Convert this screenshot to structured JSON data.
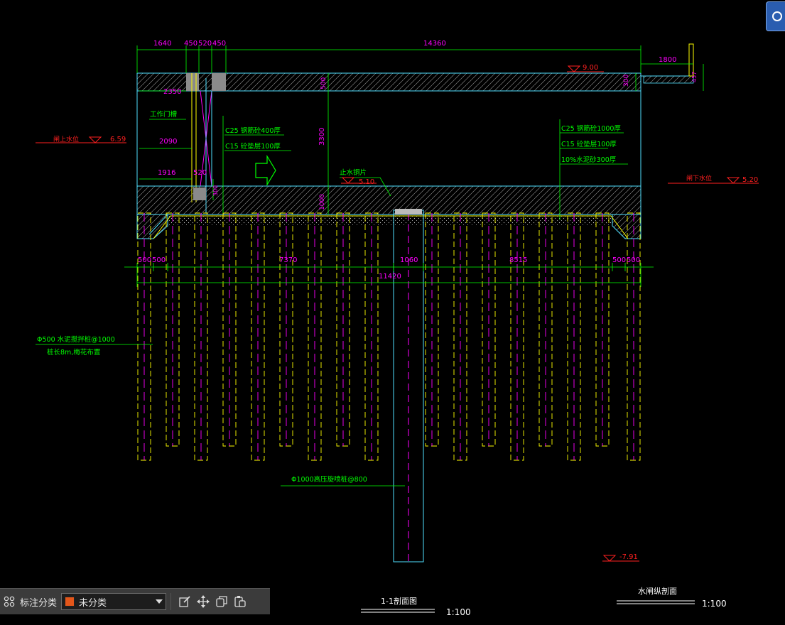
{
  "dimensions": {
    "top": [
      "1640",
      "450",
      "520",
      "450",
      "14360"
    ],
    "right_offset": "1800",
    "right_small": "457",
    "wall_2350": "2350",
    "wall_2090": "2090",
    "wall_1916": "1916",
    "gate_520": "520",
    "slab_top": "500",
    "slab_right": "300",
    "height_3300": "3300",
    "base_1000": "1000",
    "base_small": "300",
    "bottom_row": [
      "500",
      "500",
      "7370",
      "1060",
      "8515",
      "500",
      "500"
    ],
    "bottom_total": "11420"
  },
  "levels": {
    "top": "9.00",
    "upstream": "6.59",
    "downstream": "5.20",
    "stopwater": "5.10",
    "bottom": "-7.91"
  },
  "labels": {
    "upstream_level": "闸上水位",
    "downstream_level": "闸下水位",
    "gate_slot": "工作门槽",
    "stopwater": "止水铜片",
    "left_concrete": "C25 钢筋砼400厚",
    "left_cushion": "C15 砼垫层100厚",
    "right_concrete": "C25 钢筋砼1000厚",
    "right_cushion": "C15 砼垫层100厚",
    "right_sand": "10%水泥砂300厚",
    "pile_a": "Φ500 水泥搅拌桩@1000",
    "pile_b": "桩长8m,梅花布置",
    "center_pile": "Φ1000高压旋喷桩@800"
  },
  "titles": {
    "section": "1-1剖面图",
    "section_scale": "1:100",
    "longitudinal": "水闸纵剖面",
    "longitudinal_scale": "1:100"
  },
  "toolbar": {
    "label": "标注分类",
    "selected": "未分类"
  },
  "colors": {
    "green": "#00ff00",
    "cyan": "#4fe0ff",
    "magenta": "#ff00ff",
    "yellow": "#ffff00",
    "red": "#ff2020",
    "swatch": "#e3561a"
  }
}
